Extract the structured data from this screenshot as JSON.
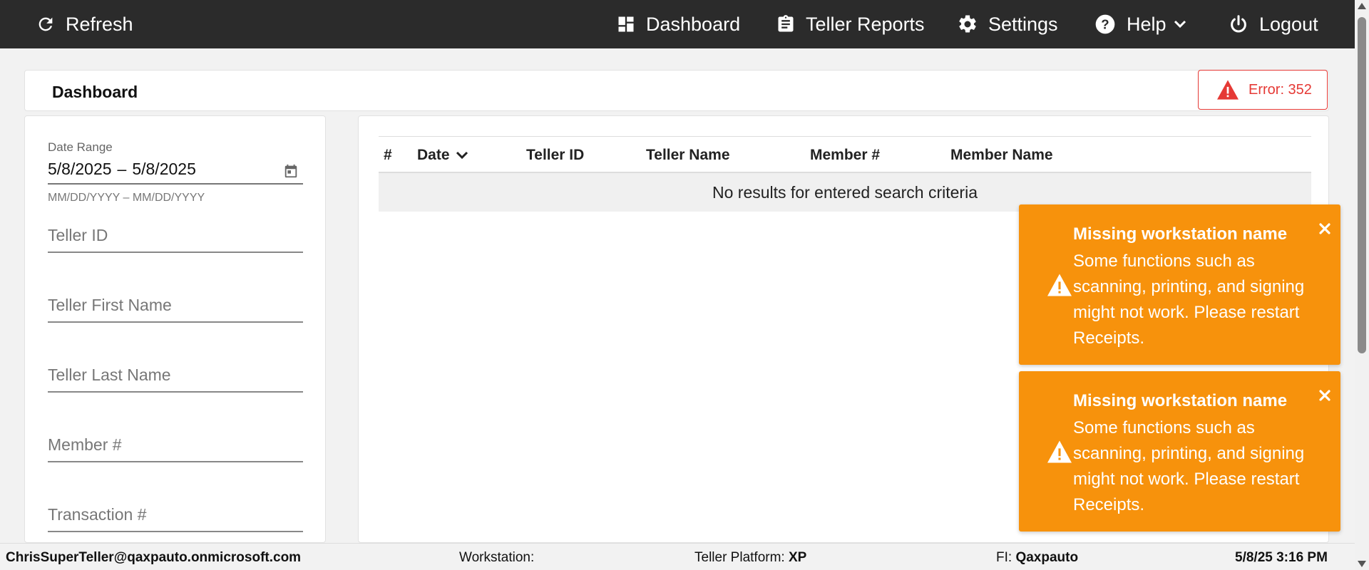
{
  "nav": {
    "refresh": "Refresh",
    "dashboard": "Dashboard",
    "teller_reports": "Teller Reports",
    "settings": "Settings",
    "help": "Help",
    "logout": "Logout"
  },
  "header": {
    "title": "Dashboard",
    "error_label": "Error: 352"
  },
  "filters": {
    "date_range_label": "Date Range",
    "date_start": "5/8/2025",
    "date_separator": "–",
    "date_end": "5/8/2025",
    "date_hint": "MM/DD/YYYY – MM/DD/YYYY",
    "teller_id_placeholder": "Teller ID",
    "teller_first_name_placeholder": "Teller First Name",
    "teller_last_name_placeholder": "Teller Last Name",
    "member_number_placeholder": "Member #",
    "transaction_number_placeholder": "Transaction #"
  },
  "table": {
    "columns": [
      "#",
      "Date",
      "Teller ID",
      "Teller Name",
      "Member #",
      "Member Name"
    ],
    "empty_message": "No results for entered search criteria"
  },
  "toasts": [
    {
      "title": "Missing workstation name",
      "body": "Some functions such as scanning, printing, and signing might not work. Please restart Receipts."
    },
    {
      "title": "Missing workstation name",
      "body": "Some functions such as scanning, printing, and signing might not work. Please restart Receipts."
    }
  ],
  "status": {
    "user": "ChrisSuperTeller@qaxpauto.onmicrosoft.com",
    "workstation_label": "Workstation:",
    "workstation_value": "",
    "platform_label": "Teller Platform:",
    "platform_value": "XP",
    "fi_label": "FI:",
    "fi_value": "Qaxpauto",
    "datetime": "5/8/25 3:16 PM"
  },
  "colors": {
    "topbar": "#2b2b2b",
    "toast": "#f7920c",
    "error": "#e53935"
  },
  "icons": [
    "refresh-icon",
    "dashboard-icon",
    "clipboard-icon",
    "gear-icon",
    "help-icon",
    "chevron-down-icon",
    "power-icon",
    "warning-icon",
    "calendar-icon",
    "close-icon"
  ]
}
